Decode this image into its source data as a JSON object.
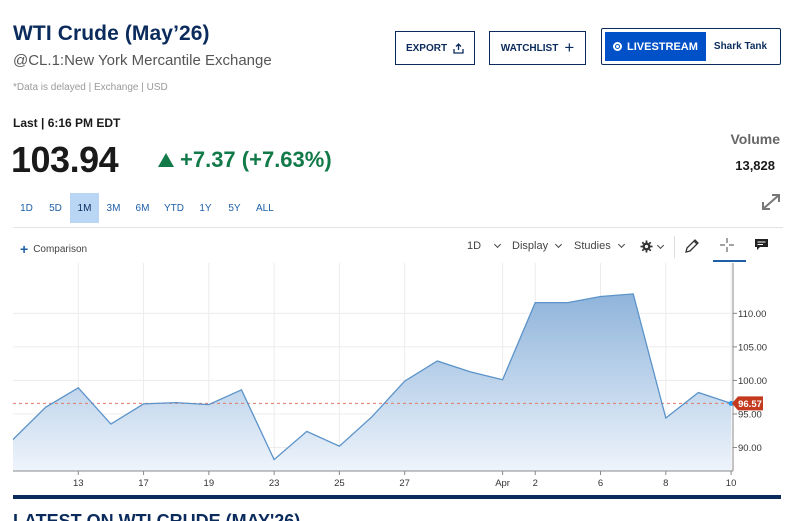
{
  "header": {
    "title": "WTI Crude (May’26)",
    "subtitle": "@CL.1:New York Mercantile Exchange",
    "disclaimer": "*Data is delayed | Exchange | USD"
  },
  "actions": {
    "export_label": "EXPORT",
    "watchlist_label": "WATCHLIST",
    "livestream_label": "LIVESTREAM",
    "show_label": "Shark Tank"
  },
  "quote": {
    "last_label": "Last | 6:16 PM EDT",
    "price": "103.94",
    "change": "+7.37 (+7.63%)",
    "volume_label": "Volume",
    "volume_value": "13,828"
  },
  "colors": {
    "brand": "#0b2b5c",
    "positive": "#127a49",
    "line": "#5b93c9",
    "reference": "#e07a6b",
    "marker": "#c43a1e",
    "accent": "#0050c8"
  },
  "ranges": [
    "1D",
    "5D",
    "1M",
    "3M",
    "6M",
    "YTD",
    "1Y",
    "5Y",
    "ALL"
  ],
  "active_range": "1M",
  "toolbar": {
    "comparison_label": "Comparison",
    "interval_label": "1D",
    "display_label": "Display",
    "studies_label": "Studies",
    "icons": [
      "gear-icon",
      "pencil-icon",
      "crosshair-icon",
      "comment-icon",
      "expand-icon"
    ]
  },
  "chart_data": {
    "type": "area",
    "x_tick_labels": [
      "13",
      "17",
      "19",
      "23",
      "25",
      "27",
      "Apr",
      "2",
      "6",
      "8",
      "10"
    ],
    "points": [
      {
        "date": "Mar 11",
        "value": 91.2
      },
      {
        "date": "Mar 12",
        "value": 96.0
      },
      {
        "date": "Mar 13",
        "value": 98.9
      },
      {
        "date": "Mar 16",
        "value": 93.5
      },
      {
        "date": "Mar 17",
        "value": 96.5
      },
      {
        "date": "Mar 18",
        "value": 96.7
      },
      {
        "date": "Mar 19",
        "value": 96.4
      },
      {
        "date": "Mar 20",
        "value": 98.6
      },
      {
        "date": "Mar 23",
        "value": 88.2
      },
      {
        "date": "Mar 24",
        "value": 92.4
      },
      {
        "date": "Mar 25",
        "value": 90.2
      },
      {
        "date": "Mar 26",
        "value": 94.6
      },
      {
        "date": "Mar 27",
        "value": 99.9
      },
      {
        "date": "Mar 30",
        "value": 102.9
      },
      {
        "date": "Mar 31",
        "value": 101.3
      },
      {
        "date": "Apr 1",
        "value": 100.1
      },
      {
        "date": "Apr 2",
        "value": 111.6
      },
      {
        "date": "Apr 3",
        "value": 111.6
      },
      {
        "date": "Apr 6",
        "value": 112.5
      },
      {
        "date": "Apr 7",
        "value": 112.9
      },
      {
        "date": "Apr 8",
        "value": 94.4
      },
      {
        "date": "Apr 9",
        "value": 98.2
      },
      {
        "date": "Apr 10",
        "value": 96.57
      }
    ],
    "y_ticks": [
      "110.00",
      "105.00",
      "100.00",
      "95.00",
      "90.00"
    ],
    "ylim": [
      86.5,
      117.5
    ],
    "last_value_label": "96.57",
    "reference_value": 96.57,
    "grid": true,
    "y_axis_position": "right"
  }
}
